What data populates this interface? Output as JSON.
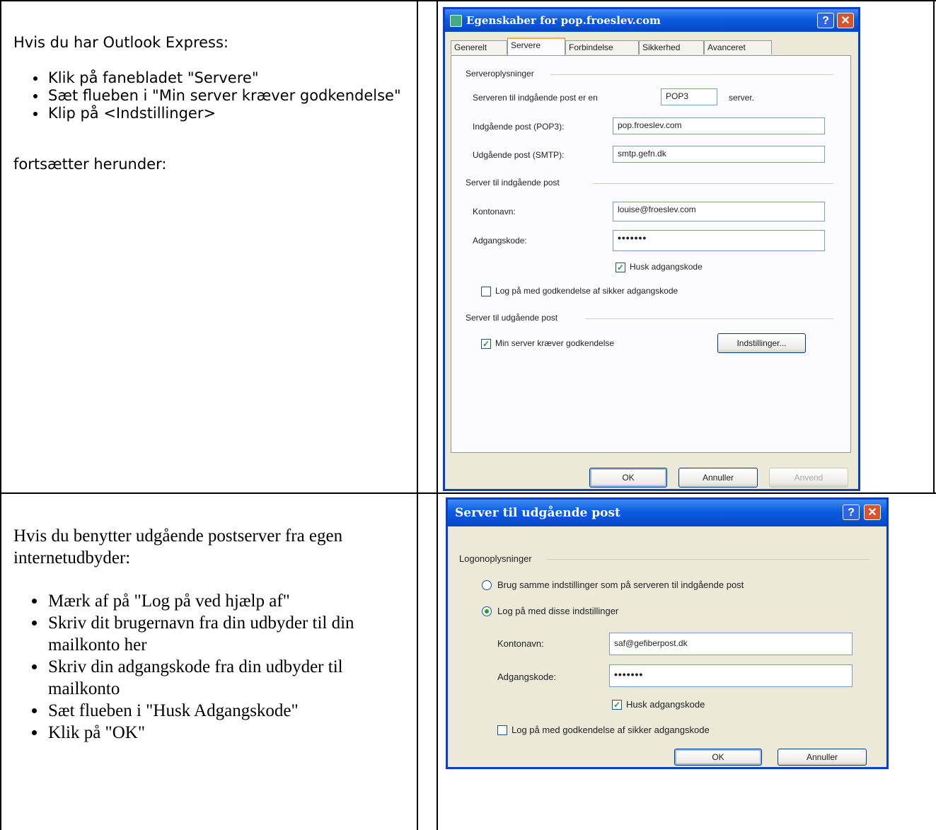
{
  "row1": {
    "intro": "Hvis du har Outlook Express:",
    "bullets": [
      "Klik på fanebladet \"Servere\"",
      "Sæt flueben i \"Min server kræver godkendelse\"",
      "Klip på <Indstillinger>"
    ],
    "outro": "fortsætter herunder:"
  },
  "row2": {
    "intro": "Hvis du benytter udgående postserver fra egen internetudbyder:",
    "bullets": [
      "Mærk af på \"Log på ved  hjælp af\"",
      "Skriv dit brugernavn fra din udbyder til din mailkonto her",
      "Skriv din adgangskode fra din udbyder til mailkonto",
      "Sæt flueben i \"Husk Adgangskode\"",
      "Klik på \"OK\""
    ]
  },
  "dialog1": {
    "title": "Egenskaber for pop.froeslev.com",
    "help_glyph": "?",
    "close_glyph": "✕",
    "tabs": [
      "Generelt",
      "Servere",
      "Forbindelse",
      "Sikkerhed",
      "Avanceret"
    ],
    "group_server_info": "Serveroplysninger",
    "incoming_type_label": "Serveren til indgående post er en",
    "incoming_type_value": "POP3",
    "incoming_type_suffix": "server.",
    "incoming_label": "Indgående post (POP3):",
    "incoming_value": "pop.froeslev.com",
    "outgoing_label": "Udgående post (SMTP):",
    "outgoing_value": "smtp.gefn.dk",
    "group_incoming": "Server til indgående post",
    "account_label": "Kontonavn:",
    "account_value": "louise@froeslev.com",
    "password_label": "Adgangskode:",
    "password_value": "•••••••",
    "remember_label": "Husk adgangskode",
    "remember_checked": true,
    "spa_label": "Log på med godkendelse af sikker adgangskode",
    "spa_checked": false,
    "group_outgoing": "Server til udgående post",
    "auth_label": "Min server kræver godkendelse",
    "auth_checked": true,
    "settings_button": "Indstillinger...",
    "ok_button": "OK",
    "cancel_button": "Annuller",
    "apply_button": "Anvend"
  },
  "dialog2": {
    "title": "Server til udgående post",
    "help_glyph": "?",
    "close_glyph": "✕",
    "group_logon": "Logonoplysninger",
    "radio_same_label": "Brug samme indstillinger som på serveren til indgående post",
    "radio_logon_label": "Log på med disse indstillinger",
    "selected_radio": "logon",
    "account_label": "Kontonavn:",
    "account_value": "saf@gefiberpost.dk",
    "password_label": "Adgangskode:",
    "password_value": "•••••••",
    "remember_label": "Husk adgangskode",
    "remember_checked": true,
    "spa_label": "Log på med godkendelse af sikker adgangskode",
    "spa_checked": false,
    "ok_button": "OK",
    "cancel_button": "Annuller"
  }
}
